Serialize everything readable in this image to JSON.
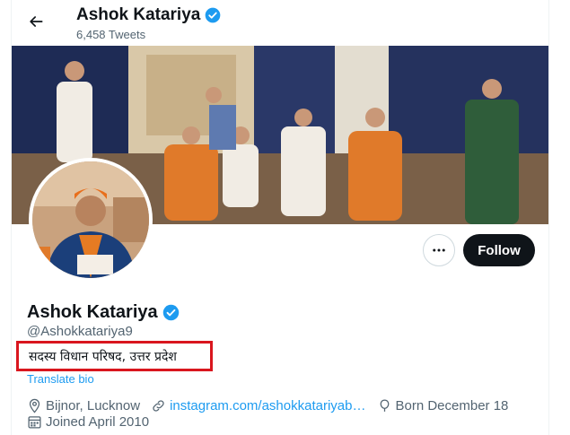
{
  "header": {
    "name": "Ashok Katariya",
    "tweet_count": "6,458 Tweets"
  },
  "profile": {
    "name": "Ashok Katariya",
    "handle": "@Ashokkatariya9",
    "bio": "सदस्य विधान परिषद, उत्तर प्रदेश",
    "translate_label": "Translate bio",
    "location": "Bijnor, Lucknow",
    "website": "instagram.com/ashokkatariyab…",
    "birthday": "Born December 18",
    "joined": "Joined April 2010"
  },
  "actions": {
    "follow_label": "Follow"
  },
  "colors": {
    "accent": "#1d9bf0",
    "follow_bg": "#0f1419",
    "highlight_border": "#d9161e",
    "secondary_text": "#536471"
  },
  "icons": [
    "back-arrow-icon",
    "verified-badge-icon",
    "more-icon",
    "location-icon",
    "link-icon",
    "birthday-icon",
    "calendar-icon"
  ]
}
